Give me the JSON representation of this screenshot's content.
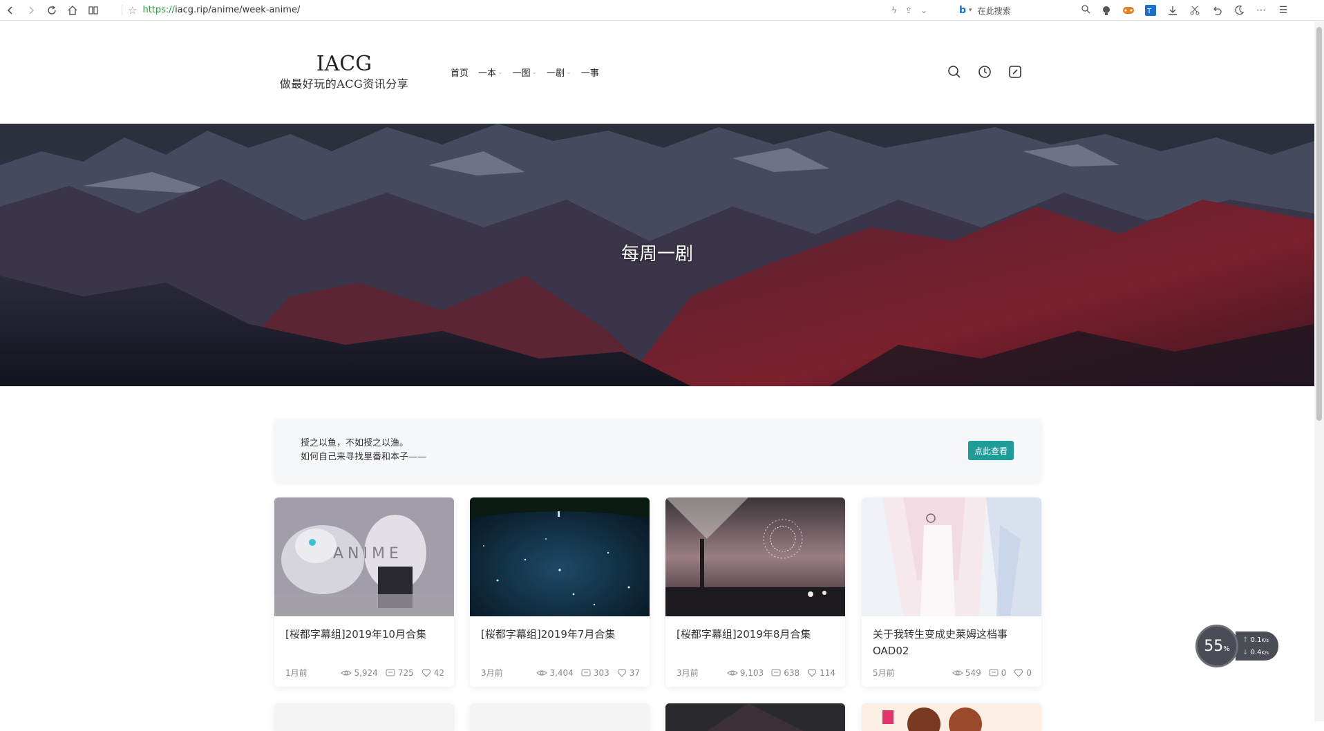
{
  "browser": {
    "url_scheme": "https://",
    "url_rest": "iacg.rip/anime/week-anime/",
    "search_placeholder": "在此搜索",
    "back_icon": "back-arrow-icon",
    "forward_icon": "forward-arrow-icon",
    "reload_icon": "reload-icon",
    "home_icon": "home-icon"
  },
  "site": {
    "logo_title": "IACG",
    "logo_subtitle": "做最好玩的ACG资讯分享",
    "nav": [
      {
        "label": "首页",
        "has_caret": false
      },
      {
        "label": "一本",
        "has_caret": true
      },
      {
        "label": "一图",
        "has_caret": true
      },
      {
        "label": "一剧",
        "has_caret": true
      },
      {
        "label": "一事",
        "has_caret": false
      }
    ]
  },
  "hero": {
    "title": "每周一剧"
  },
  "notice": {
    "line1": "授之以鱼，不如授之以渔。",
    "line2": "如何自己来寻找里番和本子——",
    "button": "点此查看",
    "button_color": "#1f9c99"
  },
  "cards": [
    {
      "title": "[桜都字幕组]2019年10月合集",
      "time": "1月前",
      "views": "5,924",
      "comments": "725",
      "likes": "42"
    },
    {
      "title": "[桜都字幕组]2019年7月合集",
      "time": "3月前",
      "views": "3,404",
      "comments": "303",
      "likes": "37"
    },
    {
      "title": "[桜都字幕组]2019年8月合集",
      "time": "3月前",
      "views": "9,103",
      "comments": "638",
      "likes": "114"
    },
    {
      "title": "关于我转生变成史莱姆这档事OAD02",
      "time": "5月前",
      "views": "549",
      "comments": "0",
      "likes": "0"
    }
  ],
  "speed_widget": {
    "percent": "55",
    "percent_unit": "%",
    "upload": "0.1",
    "download": "0.4",
    "unit": "K/s"
  }
}
